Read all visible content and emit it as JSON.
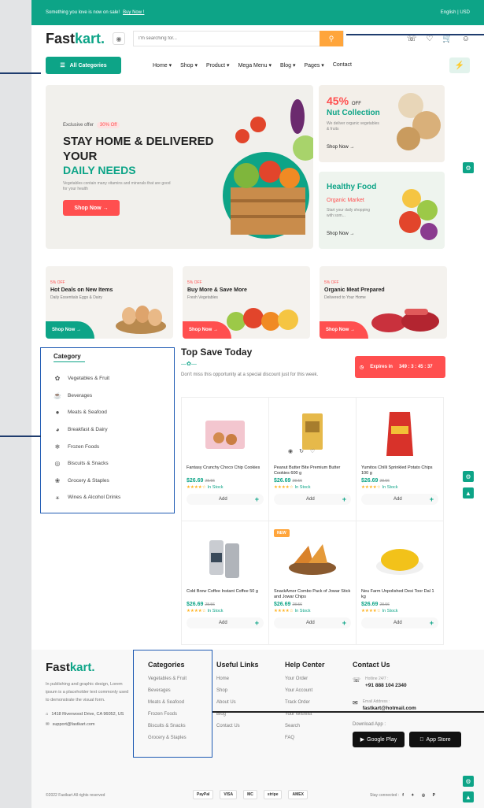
{
  "topbar": {
    "text": "Something you love is now on sale!",
    "link": "Buy Now !",
    "lang": "English",
    "currency": "USD"
  },
  "header": {
    "logo_a": "Fast",
    "logo_b": "kart.",
    "search_placeholder": "I'm searching for..."
  },
  "nav": {
    "all_categories": "All Categories",
    "menu": [
      "Home",
      "Shop",
      "Product",
      "Mega Menu",
      "Blog",
      "Pages",
      "Contact"
    ]
  },
  "hero": {
    "exclusive": "Exclusive offer",
    "badge": "30% Off",
    "title": "STAY HOME & DELIVERED YOUR",
    "highlight": "DAILY NEEDS",
    "desc": "Vegetables contain many vitamins and minerals that are good for your health",
    "button": "Shop Now"
  },
  "side1": {
    "percent": "45%",
    "off": "OFF",
    "title": "Nut Collection",
    "desc": "We deliver organic vegetables & fruits",
    "link": "Shop Now"
  },
  "side2": {
    "title": "Healthy Food",
    "subtitle": "Organic Market",
    "desc": "Start your daily shopping with som...",
    "link": "Shop Now"
  },
  "banners": [
    {
      "off": "5% OFF",
      "title": "Hot Deals on New Items",
      "desc": "Daily Essentials Eggs & Dairy",
      "button": "Shop Now",
      "color": "#0da487"
    },
    {
      "off": "5% OFF",
      "title": "Buy More & Save More",
      "desc": "Fresh Vegetables",
      "button": "Shop Now",
      "color": "#ff4f4f"
    },
    {
      "off": "5% OFF",
      "title": "Organic Meat Prepared",
      "desc": "Delivered to Your Home",
      "button": "Shop Now",
      "color": "#ff4f4f"
    }
  ],
  "category": {
    "title": "Category",
    "items": [
      "Vegetables & Fruit",
      "Beverages",
      "Meats & Seafood",
      "Breakfast & Dairy",
      "Frozen Foods",
      "Biscuits & Snacks",
      "Grocery & Staples",
      "Wines & Alcohol Drinks"
    ]
  },
  "topsave": {
    "title": "Top Save Today",
    "desc": "Don't miss this opportunity at a special discount just for this week.",
    "expires": "Expires in",
    "timer": "349 : 3 : 45 : 37"
  },
  "products": [
    {
      "name": "Fantasy Crunchy Choco Chip Cookies",
      "price": "$26.69",
      "old": "28.56",
      "stock": "In Stock"
    },
    {
      "name": "Peanut Butter Bite Premium Butter Cookies 600 g",
      "price": "$26.69",
      "old": "28.56",
      "stock": "In Stock"
    },
    {
      "name": "Yumitos Chilli Sprinkled Potato Chips 100 g",
      "price": "$26.69",
      "old": "28.56",
      "stock": "In Stock"
    },
    {
      "name": "Cold Brew Coffee Instant Coffee 50 g",
      "price": "$26.69",
      "old": "28.56",
      "stock": "In Stock"
    },
    {
      "name": "SnackAmor Combo Pack of Jowar Stick and Jowar Chips",
      "price": "$26.69",
      "old": "28.56",
      "stock": "In Stock"
    },
    {
      "name": "Neu Farm Unpolished Desi Toor Dal 1 kg",
      "price": "$26.69",
      "old": "28.56",
      "stock": "In Stock"
    }
  ],
  "add_label": "Add",
  "new_label": "NEW",
  "footer": {
    "about": "In publishing and graphic design, Lorem ipsum is a placeholder text commonly used to demonstrate the visual form.",
    "address": "1418 Riverwood Drive, CA 96052, US",
    "email": "support@fastkart.com",
    "cat_title": "Categories",
    "cats": [
      "Vegetables & Fruit",
      "Beverages",
      "Meats & Seafood",
      "Frozen Foods",
      "Biscuits & Snacks",
      "Grocery & Staples"
    ],
    "links_title": "Useful Links",
    "links": [
      "Home",
      "Shop",
      "About Us",
      "Blog",
      "Contact Us"
    ],
    "help_title": "Help Center",
    "help": [
      "Your Order",
      "Your Account",
      "Track Order",
      "Your Wishlist",
      "Search",
      "FAQ"
    ],
    "contact_title": "Contact Us",
    "hotline_label": "Hotline 24/7 :",
    "hotline": "+91 888 104 2340",
    "email_label": "Email Address :",
    "email2": "fastkart@hotmail.com",
    "download": "Download App :",
    "google": "Google Play",
    "apple": "App Store",
    "copy": "©2022 Fastkart All rights reserved",
    "pay": [
      "PayPal",
      "VISA",
      "MC",
      "stripe",
      "AMEX"
    ],
    "stay": "Stay connected :"
  }
}
